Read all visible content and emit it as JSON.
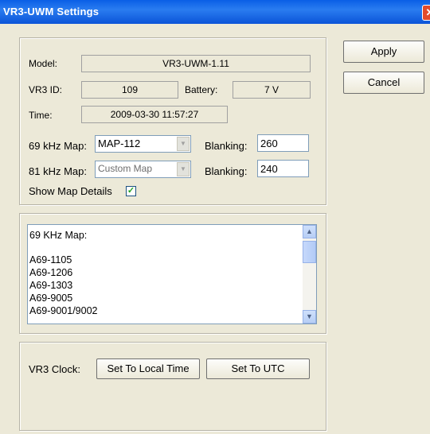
{
  "window": {
    "title": "VR3-UWM Settings",
    "close_glyph": "✕"
  },
  "device": {
    "model_label": "Model:",
    "model_value": "VR3-UWM-1.11",
    "id_label": "VR3 ID:",
    "id_value": "109",
    "battery_label": "Battery:",
    "battery_value": "7 V",
    "time_label": "Time:",
    "time_value": "2009-03-30  11:57:27"
  },
  "maps": {
    "map69_label": "69 kHz Map:",
    "map69_value": "MAP-112",
    "blank69_label": "Blanking:",
    "blank69_value": "260",
    "map81_label": "81 kHz Map:",
    "map81_value": "Custom Map",
    "blank81_label": "Blanking:",
    "blank81_value": "240",
    "show_details_label": "Show Map Details",
    "show_details_checked": true
  },
  "details": {
    "lines": [
      "69 KHz Map:",
      "",
      "A69-1105",
      "A69-1206",
      "A69-1303",
      "A69-9005",
      "A69-9001/9002"
    ]
  },
  "clock": {
    "label": "VR3 Clock:",
    "local_button": "Set To Local Time",
    "utc_button": "Set To UTC"
  },
  "buttons": {
    "apply": "Apply",
    "cancel": "Cancel"
  },
  "icons": {
    "combo_arrow": "chevron-down-icon",
    "scroll_up": "scroll-up-icon",
    "scroll_down": "scroll-down-icon",
    "check": "checkmark-icon",
    "close": "close-icon"
  }
}
